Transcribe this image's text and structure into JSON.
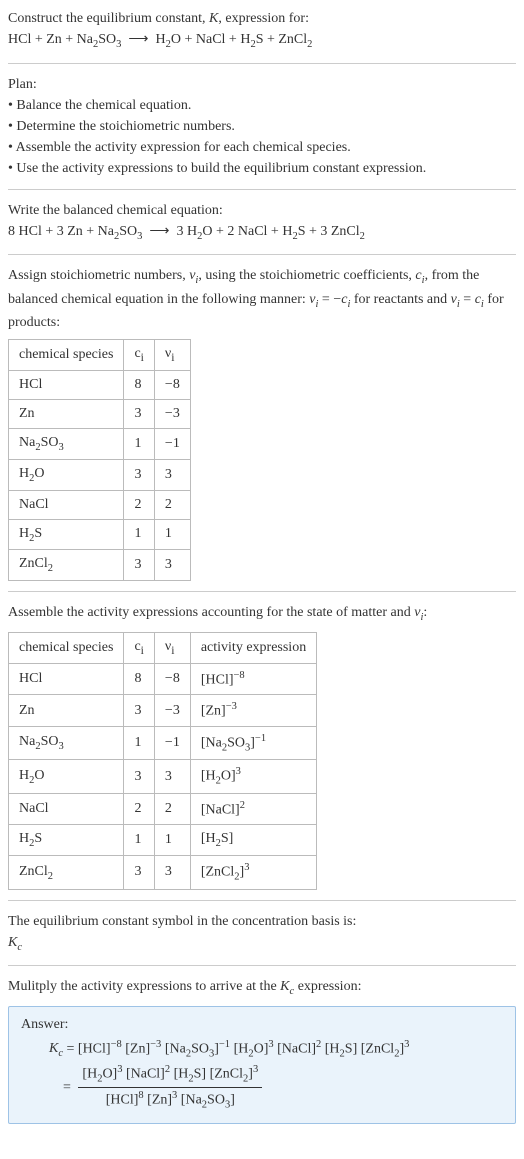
{
  "construct": {
    "title_html": "Construct the equilibrium constant, <span class='it'>K</span>, expression for:",
    "equation_html": "HCl + Zn + Na<span class='sub'>2</span>SO<span class='sub'>3</span>&nbsp;&nbsp;⟶&nbsp;&nbsp;H<span class='sub'>2</span>O + NaCl + H<span class='sub'>2</span>S + ZnCl<span class='sub'>2</span>"
  },
  "plan": {
    "title": "Plan:",
    "items": [
      "• Balance the chemical equation.",
      "• Determine the stoichiometric numbers.",
      "• Assemble the activity expression for each chemical species.",
      "• Use the activity expressions to build the equilibrium constant expression."
    ]
  },
  "balanced": {
    "title": "Write the balanced chemical equation:",
    "equation_html": "8 HCl + 3 Zn + Na<span class='sub'>2</span>SO<span class='sub'>3</span>&nbsp;&nbsp;⟶&nbsp;&nbsp;3 H<span class='sub'>2</span>O + 2 NaCl + H<span class='sub'>2</span>S + 3 ZnCl<span class='sub'>2</span>"
  },
  "stoich": {
    "intro_html": "Assign stoichiometric numbers, <span class='it'>ν<span class='sub'>i</span></span>, using the stoichiometric coefficients, <span class='it'>c<span class='sub'>i</span></span>, from the balanced chemical equation in the following manner: <span class='it'>ν<span class='sub'>i</span></span> = −<span class='it'>c<span class='sub'>i</span></span> for reactants and <span class='it'>ν<span class='sub'>i</span></span> = <span class='it'>c<span class='sub'>i</span></span> for products:",
    "headers": [
      "chemical species",
      "c<sub>i</sub>",
      "ν<sub>i</sub>"
    ],
    "rows": [
      {
        "species_html": "HCl",
        "c": "8",
        "v": "−8"
      },
      {
        "species_html": "Zn",
        "c": "3",
        "v": "−3"
      },
      {
        "species_html": "Na<span class='sub'>2</span>SO<span class='sub'>3</span>",
        "c": "1",
        "v": "−1"
      },
      {
        "species_html": "H<span class='sub'>2</span>O",
        "c": "3",
        "v": "3"
      },
      {
        "species_html": "NaCl",
        "c": "2",
        "v": "2"
      },
      {
        "species_html": "H<span class='sub'>2</span>S",
        "c": "1",
        "v": "1"
      },
      {
        "species_html": "ZnCl<span class='sub'>2</span>",
        "c": "3",
        "v": "3"
      }
    ]
  },
  "activity": {
    "intro_html": "Assemble the activity expressions accounting for the state of matter and <span class='it'>ν<span class='sub'>i</span></span>:",
    "headers": [
      "chemical species",
      "c<sub>i</sub>",
      "ν<sub>i</sub>",
      "activity expression"
    ],
    "rows": [
      {
        "species_html": "HCl",
        "c": "8",
        "v": "−8",
        "act_html": "[HCl]<span class='sup'>−8</span>"
      },
      {
        "species_html": "Zn",
        "c": "3",
        "v": "−3",
        "act_html": "[Zn]<span class='sup'>−3</span>"
      },
      {
        "species_html": "Na<span class='sub'>2</span>SO<span class='sub'>3</span>",
        "c": "1",
        "v": "−1",
        "act_html": "[Na<span class='sub'>2</span>SO<span class='sub'>3</span>]<span class='sup'>−1</span>"
      },
      {
        "species_html": "H<span class='sub'>2</span>O",
        "c": "3",
        "v": "3",
        "act_html": "[H<span class='sub'>2</span>O]<span class='sup'>3</span>"
      },
      {
        "species_html": "NaCl",
        "c": "2",
        "v": "2",
        "act_html": "[NaCl]<span class='sup'>2</span>"
      },
      {
        "species_html": "H<span class='sub'>2</span>S",
        "c": "1",
        "v": "1",
        "act_html": "[H<span class='sub'>2</span>S]"
      },
      {
        "species_html": "ZnCl<span class='sub'>2</span>",
        "c": "3",
        "v": "3",
        "act_html": "[ZnCl<span class='sub'>2</span>]<span class='sup'>3</span>"
      }
    ]
  },
  "kc_symbol": {
    "line1": "The equilibrium constant symbol in the concentration basis is:",
    "line2_html": "<span class='it'>K<span class='sub'>c</span></span>"
  },
  "multiply_intro_html": "Mulitply the activity expressions to arrive at the <span class='it'>K<span class='sub'>c</span></span> expression:",
  "answer": {
    "title": "Answer:",
    "line1_html": "<span class='it'>K<span class='sub'>c</span></span> = [HCl]<span class='sup'>−8</span> [Zn]<span class='sup'>−3</span> [Na<span class='sub'>2</span>SO<span class='sub'>3</span>]<span class='sup'>−1</span> [H<span class='sub'>2</span>O]<span class='sup'>3</span> [NaCl]<span class='sup'>2</span> [H<span class='sub'>2</span>S] [ZnCl<span class='sub'>2</span>]<span class='sup'>3</span>",
    "eq": "=",
    "num_html": "[H<span class='sub'>2</span>O]<span class='sup'>3</span> [NaCl]<span class='sup'>2</span> [H<span class='sub'>2</span>S] [ZnCl<span class='sub'>2</span>]<span class='sup'>3</span>",
    "den_html": "[HCl]<span class='sup'>8</span> [Zn]<span class='sup'>3</span> [Na<span class='sub'>2</span>SO<span class='sub'>3</span>]"
  }
}
